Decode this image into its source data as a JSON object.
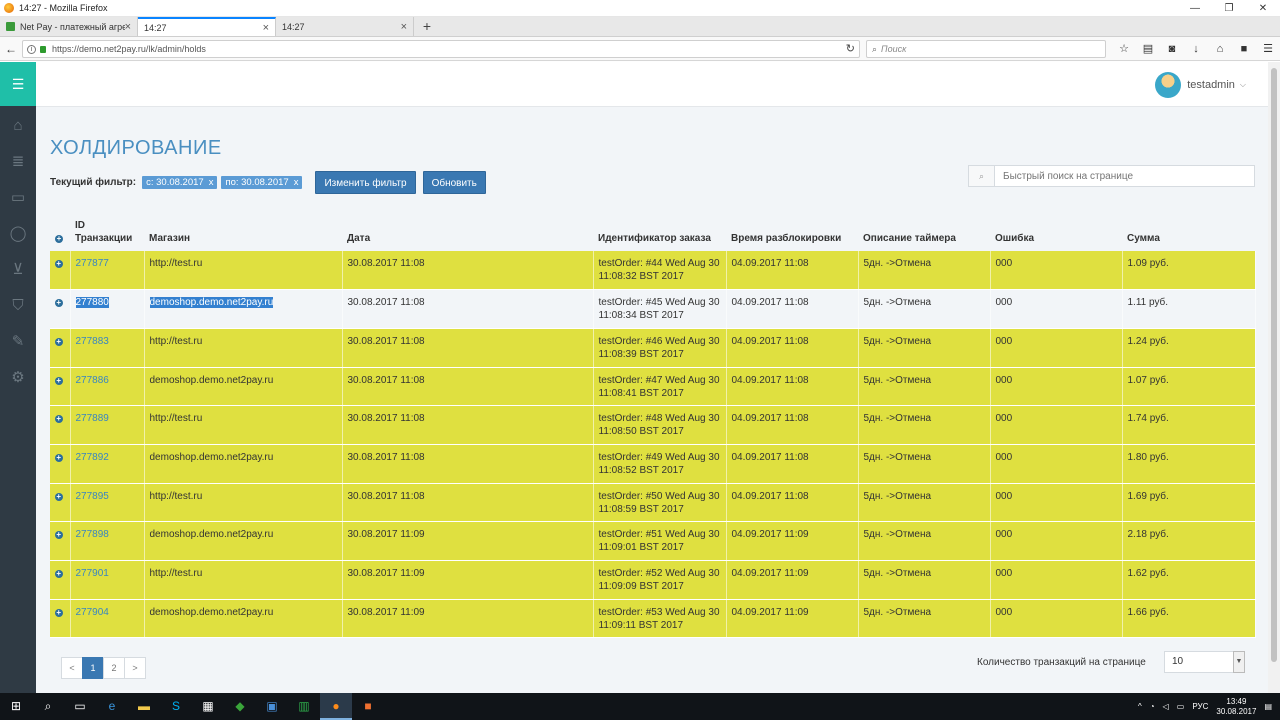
{
  "window": {
    "title": "14:27 - Mozilla Firefox",
    "controls": {
      "minimize": "—",
      "restore": "❐",
      "close": "✕"
    }
  },
  "tabs": [
    {
      "label": "Net Pay - платежный агрег",
      "active": false
    },
    {
      "label": "14:27",
      "active": true
    },
    {
      "label": "14:27",
      "active": false
    }
  ],
  "newtab_label": "+",
  "navbar": {
    "url": "https://demo.net2pay.ru/lk/admin/holds",
    "search_placeholder": "Поиск"
  },
  "header": {
    "username": "testadmin"
  },
  "page": {
    "title": "ХОЛДИРОВАНИЕ",
    "filter_label": "Текущий фильтр:",
    "chip_from": "с: 30.08.2017",
    "chip_to": "по: 30.08.2017",
    "chip_remove": "x",
    "change_filter": "Изменить фильтр",
    "refresh": "Обновить",
    "quick_search_placeholder": "Быстрый поиск на странице"
  },
  "table": {
    "headers": [
      "ID Транзакции",
      "Магазин",
      "Дата",
      "Идентификатор заказа",
      "Время разблокировки",
      "Описание таймера",
      "Ошибка",
      "Сумма"
    ],
    "rows": [
      {
        "id": "277877",
        "shop": "http://test.ru",
        "date": "30.08.2017 11:08",
        "order": "testOrder: #44 Wed Aug 30 11:08:32 BST 2017",
        "unlock": "04.09.2017 11:08",
        "timer": "5дн. ->Отмена",
        "error": "000",
        "amount": "1.09 руб."
      },
      {
        "id": "277880",
        "shop": "demoshop.demo.net2pay.ru",
        "date": "30.08.2017 11:08",
        "order": "testOrder: #45 Wed Aug 30 11:08:34 BST 2017",
        "unlock": "04.09.2017 11:08",
        "timer": "5дн. ->Отмена",
        "error": "000",
        "amount": "1.11 руб."
      },
      {
        "id": "277883",
        "shop": "http://test.ru",
        "date": "30.08.2017 11:08",
        "order": "testOrder: #46 Wed Aug 30 11:08:39 BST 2017",
        "unlock": "04.09.2017 11:08",
        "timer": "5дн. ->Отмена",
        "error": "000",
        "amount": "1.24 руб."
      },
      {
        "id": "277886",
        "shop": "demoshop.demo.net2pay.ru",
        "date": "30.08.2017 11:08",
        "order": "testOrder: #47 Wed Aug 30 11:08:41 BST 2017",
        "unlock": "04.09.2017 11:08",
        "timer": "5дн. ->Отмена",
        "error": "000",
        "amount": "1.07 руб."
      },
      {
        "id": "277889",
        "shop": "http://test.ru",
        "date": "30.08.2017 11:08",
        "order": "testOrder: #48 Wed Aug 30 11:08:50 BST 2017",
        "unlock": "04.09.2017 11:08",
        "timer": "5дн. ->Отмена",
        "error": "000",
        "amount": "1.74 руб."
      },
      {
        "id": "277892",
        "shop": "demoshop.demo.net2pay.ru",
        "date": "30.08.2017 11:08",
        "order": "testOrder: #49 Wed Aug 30 11:08:52 BST 2017",
        "unlock": "04.09.2017 11:08",
        "timer": "5дн. ->Отмена",
        "error": "000",
        "amount": "1.80 руб."
      },
      {
        "id": "277895",
        "shop": "http://test.ru",
        "date": "30.08.2017 11:08",
        "order": "testOrder: #50 Wed Aug 30 11:08:59 BST 2017",
        "unlock": "04.09.2017 11:08",
        "timer": "5дн. ->Отмена",
        "error": "000",
        "amount": "1.69 руб."
      },
      {
        "id": "277898",
        "shop": "demoshop.demo.net2pay.ru",
        "date": "30.08.2017 11:09",
        "order": "testOrder: #51 Wed Aug 30 11:09:01 BST 2017",
        "unlock": "04.09.2017 11:09",
        "timer": "5дн. ->Отмена",
        "error": "000",
        "amount": "2.18 руб."
      },
      {
        "id": "277901",
        "shop": "http://test.ru",
        "date": "30.08.2017 11:09",
        "order": "testOrder: #52 Wed Aug 30 11:09:09 BST 2017",
        "unlock": "04.09.2017 11:09",
        "timer": "5дн. ->Отмена",
        "error": "000",
        "amount": "1.62 руб."
      },
      {
        "id": "277904",
        "shop": "demoshop.demo.net2pay.ru",
        "date": "30.08.2017 11:09",
        "order": "testOrder: #53 Wed Aug 30 11:09:11 BST 2017",
        "unlock": "04.09.2017 11:09",
        "timer": "5дн. ->Отмена",
        "error": "000",
        "amount": "1.66 руб."
      }
    ],
    "highlight_color": "#dfe040",
    "selected_row": 1
  },
  "pagination": {
    "prev": "<",
    "pages": [
      "1",
      "2"
    ],
    "current": "1",
    "next": ">"
  },
  "per_page": {
    "label": "Количество транзакций на странице",
    "value": "10"
  },
  "taskbar": {
    "lang": "РУС",
    "time": "13:49",
    "date": "30.08.2017"
  },
  "colors": {
    "accent": "#1fbfa8",
    "sidebar": "#2f3a44",
    "button": "#3a78b2",
    "title": "#4a8fc1",
    "row_highlight": "#dfe040"
  }
}
